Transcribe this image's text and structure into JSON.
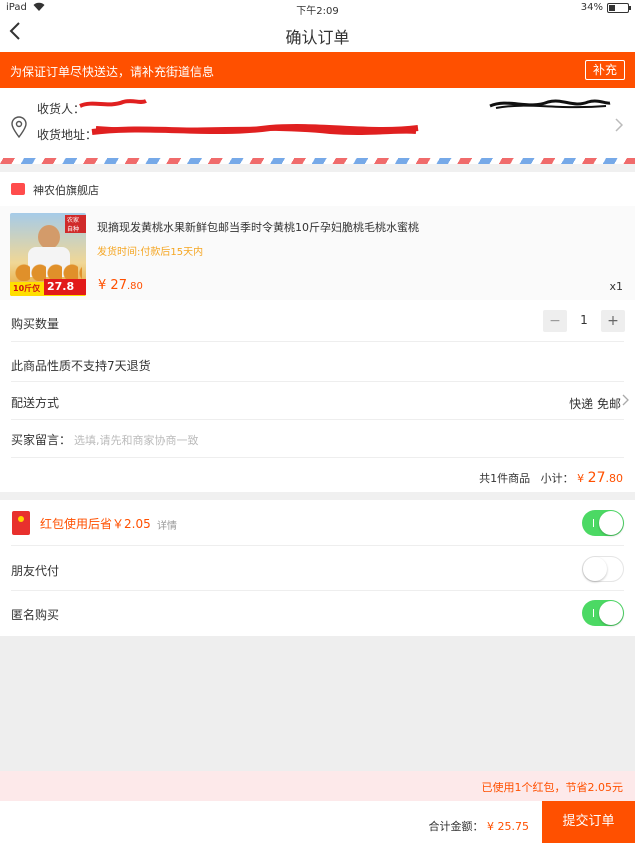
{
  "status_bar": {
    "device": "iPad",
    "time": "下午2:09",
    "battery": "34%"
  },
  "nav": {
    "title": "确认订单"
  },
  "notice": {
    "text": "为保证订单尽快送达，请补充街道信息",
    "button": "补充"
  },
  "address": {
    "recipient_label": "收货人：",
    "address_label": "收货地址："
  },
  "shop": {
    "name": "神农伯旗舰店"
  },
  "product": {
    "title": "现摘现发黄桃水果新鲜包邮当季时令黄桃10斤孕妇脆桃毛桃水蜜桃",
    "ship_time": "发货时间:付款后15天内",
    "price_symbol": "¥",
    "price_int": "27",
    "price_dec": ".80",
    "quantity_tag": "x1",
    "image": {
      "badge": "农家自种",
      "promo_text": "10斤仅",
      "promo_price": "27.8元"
    }
  },
  "purchase_qty": {
    "label": "购买数量",
    "minus": "−",
    "value": "1",
    "plus": "+"
  },
  "no_return": {
    "label": "此商品性质不支持7天退货"
  },
  "delivery": {
    "label": "配送方式",
    "value": "快递 免邮"
  },
  "message": {
    "label": "买家留言：",
    "placeholder": "选填,请先和商家协商一致"
  },
  "subtotal": {
    "count_text": "共1件商品",
    "label": "小计：",
    "symbol": "¥",
    "int": "27",
    "dec": ".80"
  },
  "redpack": {
    "text": "红包使用后省￥2.05",
    "detail": "详情",
    "on": true
  },
  "friend_pay": {
    "label": "朋友代付",
    "on": false
  },
  "anonymous": {
    "label": "匿名购买",
    "on": true
  },
  "savings": {
    "text": "已使用1个红包，节省2.05元"
  },
  "footer": {
    "total_label": "合计金额：",
    "total_value": "¥ 25.75",
    "submit": "提交订单"
  },
  "colors": {
    "accent": "#ff5000",
    "toggle_on": "#4cd964"
  }
}
